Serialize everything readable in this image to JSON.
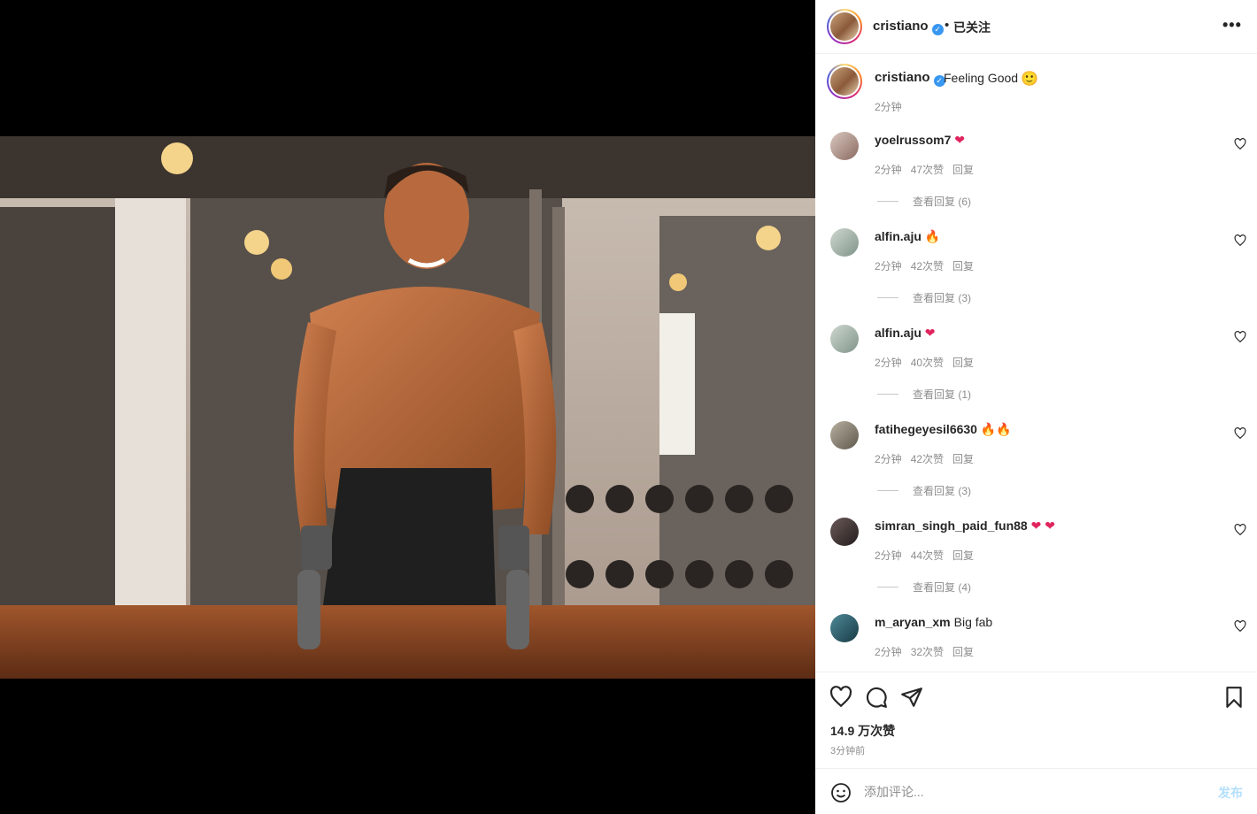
{
  "header": {
    "username": "cristiano",
    "separator": "•",
    "follow_status": "已关注",
    "more_icon": "more-horizontal-icon"
  },
  "caption": {
    "username": "cristiano",
    "text": "Feeling Good",
    "emoji": "🙂",
    "time": "2分钟"
  },
  "comments": [
    {
      "username": "yoelrussom7",
      "text": "",
      "emoji": "❤",
      "time": "2分钟",
      "likes": "47次赞",
      "reply_label": "回复",
      "view_replies": "查看回复 (6)"
    },
    {
      "username": "alfin.aju",
      "text": "",
      "emoji": "🔥",
      "time": "2分钟",
      "likes": "42次赞",
      "reply_label": "回复",
      "view_replies": "查看回复 (3)"
    },
    {
      "username": "alfin.aju",
      "text": "",
      "emoji": "❤",
      "time": "2分钟",
      "likes": "40次赞",
      "reply_label": "回复",
      "view_replies": "查看回复 (1)"
    },
    {
      "username": "fatihegeyesil6630",
      "text": "",
      "emoji": "🔥🔥",
      "time": "2分钟",
      "likes": "42次赞",
      "reply_label": "回复",
      "view_replies": "查看回复 (3)"
    },
    {
      "username": "simran_singh_paid_fun88",
      "text": "",
      "emoji": "❤ ❤",
      "time": "2分钟",
      "likes": "44次赞",
      "reply_label": "回复",
      "view_replies": "查看回复 (4)"
    },
    {
      "username": "m_aryan_xm",
      "text": "Big fab",
      "emoji": "",
      "time": "2分钟",
      "likes": "32次赞",
      "reply_label": "回复",
      "view_replies": ""
    }
  ],
  "actions": {
    "like_icon": "heart-icon",
    "comment_icon": "comment-icon",
    "share_icon": "send-icon",
    "save_icon": "bookmark-icon",
    "likes_count": "14.9 万次赞",
    "post_time": "3分钟前"
  },
  "composer": {
    "placeholder": "添加评论...",
    "post_label": "发布",
    "emoji_icon": "smiley-icon"
  },
  "colors": {
    "verified": "#3897f0",
    "heart": "#e0245e",
    "post_disabled": "#b2dffc"
  }
}
